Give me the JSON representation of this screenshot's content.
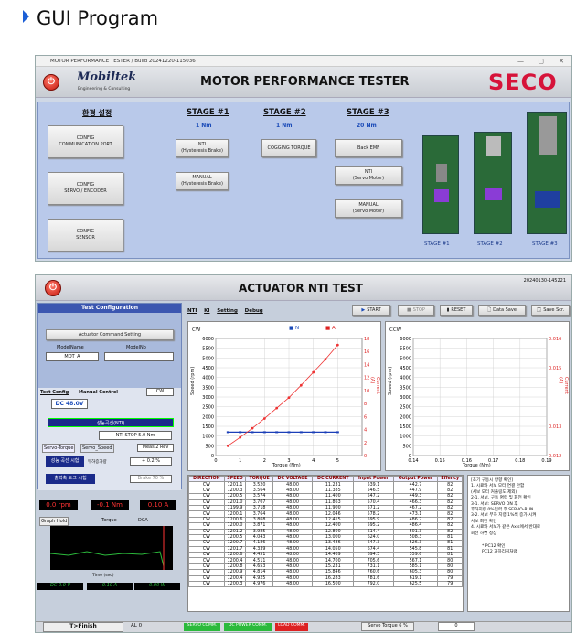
{
  "page_title": "GUI Program",
  "win1": {
    "title": "MOTOR PERFORMANCE TESTER / Build 20241220-115036",
    "logo_main": "Mobiltek",
    "logo_sub": "Engineering & Consulting",
    "heading": "MOTOR PERFORMANCE TESTER",
    "brand": "SECO",
    "env_title": "환경 설정",
    "env_buttons": [
      "CONFIG\nCOMMUNICATION PORT",
      "CONFIG\nSERVO / ENCODER",
      "CONFIG\nSENSOR"
    ],
    "stages": [
      {
        "title": "STAGE #1",
        "torque": "1 Nm",
        "buttons": [
          "NTI\n(Hysteresis Brake)",
          "MANUAL\n(Hysteresis Brake)"
        ]
      },
      {
        "title": "STAGE  #2",
        "torque": "1 Nm",
        "buttons": [
          "COGGING TORQUE"
        ]
      },
      {
        "title": "STAGE #3",
        "torque": "20 Nm",
        "buttons": [
          "Back EMF",
          "NTI\n(Servo Motor)",
          "MANUAL\n(Servo Motor)"
        ]
      }
    ],
    "stage_images": [
      "STAGE #1",
      "STAGE #2",
      "STAGE #3"
    ]
  },
  "win2": {
    "heading": "ACTUATOR NTI TEST",
    "timestamp": "20240130-145221",
    "test_config": "Test Configuration",
    "actuator_cmd": "Actuator Command Setting",
    "model_name_label": "ModelName",
    "model_no_label": "ModelNo",
    "model_name": "MOT_A",
    "model_no": "",
    "tab_test": "Test Config",
    "tab_manual": "Manual Control",
    "dir": "CW",
    "voltage": "DC 48.0V",
    "perf_curve": "성능곡선(NTI)",
    "nti_stop": "NTI STOP 5.0 Nm",
    "servo_torque_tab": "Servo-Torque",
    "servo_speed_tab": "Servo_Speed",
    "meas": "Meas 2 Rev",
    "perf_cond": "성능 곡선 시험",
    "load_dir": "부하증가량",
    "load_val": "+ 0.2 %",
    "output_torque": "출력축 토크 시험",
    "brake": "Brake 70 %",
    "rpm": "0.0 rpm",
    "nm": "-0.1 Nm",
    "amp": "0.10 A",
    "graph_hold": "Graph Hold",
    "torque_lbl": "Torque",
    "dca_lbl": "DCA",
    "time_axis": "Time (sec)",
    "dcv": "DC 0.0 V",
    "dca": "0.10 A",
    "watt": "0.00 W",
    "tabs": [
      "NTI",
      "KI",
      "Setting",
      "Debug"
    ],
    "start": "START",
    "stop": "STOP",
    "reset": "RESET",
    "data_save": "Data Save",
    "save_scr": "Save Scr.",
    "chart_cw": "CW",
    "chart_ccw": "CCW",
    "legend_n": "N",
    "legend_a": "A",
    "ylabel_speed": "Speed (rpm)",
    "ylabel_current": "Current (A)",
    "xlabel": "Torque (Nm)",
    "table_headers": [
      "DIRECTION",
      "SPEED",
      "TORQUE",
      "DC VOLTAGE",
      "DC CURRENT",
      "Input Power",
      "Output Power",
      "Effency"
    ],
    "table_rows": [
      [
        "CW",
        "1201.1",
        "3.520",
        "48.00",
        "11.231",
        "539.1",
        "442.7",
        "82"
      ],
      [
        "CW",
        "1200.3",
        "3.564",
        "48.00",
        "11.385",
        "546.5",
        "447.9",
        "82"
      ],
      [
        "CW",
        "1200.5",
        "3.574",
        "48.00",
        "11.400",
        "547.2",
        "449.3",
        "82"
      ],
      [
        "CW",
        "1201.0",
        "3.707",
        "48.00",
        "11.863",
        "570.4",
        "466.3",
        "82"
      ],
      [
        "CW",
        "1199.9",
        "3.718",
        "48.00",
        "11.900",
        "571.2",
        "467.2",
        "82"
      ],
      [
        "CW",
        "1200.1",
        "3.764",
        "48.00",
        "12.046",
        "578.2",
        "473.1",
        "82"
      ],
      [
        "CW",
        "1200.6",
        "3.868",
        "48.00",
        "12.415",
        "595.9",
        "486.2",
        "82"
      ],
      [
        "CW",
        "1200.0",
        "3.871",
        "48.00",
        "12.400",
        "595.2",
        "486.4",
        "82"
      ],
      [
        "CW",
        "1201.2",
        "3.985",
        "48.00",
        "12.800",
        "614.4",
        "501.3",
        "82"
      ],
      [
        "CW",
        "1200.5",
        "4.043",
        "48.00",
        "13.000",
        "624.0",
        "508.3",
        "81"
      ],
      [
        "CW",
        "1200.7",
        "4.186",
        "48.00",
        "13.486",
        "647.3",
        "526.3",
        "81"
      ],
      [
        "CW",
        "1201.7",
        "4.339",
        "48.00",
        "14.050",
        "674.4",
        "545.8",
        "81"
      ],
      [
        "CW",
        "1200.6",
        "4.451",
        "48.00",
        "14.469",
        "694.5",
        "559.6",
        "81"
      ],
      [
        "CW",
        "1200.4",
        "4.511",
        "48.00",
        "14.700",
        "705.6",
        "567.1",
        "80"
      ],
      [
        "CW",
        "1200.8",
        "4.653",
        "48.00",
        "15.231",
        "731.1",
        "585.1",
        "80"
      ],
      [
        "CW",
        "1200.9",
        "4.814",
        "48.00",
        "15.846",
        "760.6",
        "605.3",
        "80"
      ],
      [
        "CW",
        "1200.4",
        "4.925",
        "48.00",
        "16.283",
        "781.6",
        "619.1",
        "79"
      ],
      [
        "CW",
        "1200.3",
        "4.976",
        "48.00",
        "16.500",
        "792.0",
        "625.5",
        "79"
      ]
    ],
    "notes": "[초기 구동시 방향 확인]\n1. 시료와 서보 모터 연결 안함\n(서보 모터 커플링도 제외)\n2-1. 서보, 구동 명령 및 회전 확인\n3-1. 서보: SERVO ON 후\n후하지령 0%입력 후 SERVO-RUN\n3-2. 서보 부하 지령 1%씩 증가 시켜\n서보 회전 확인\n4. 시료와 서보가 같은 Axis에서 반대로\n회전 하면 정상",
    "notes2": "* PC12 확인\nPC12 과하리히처럼",
    "bottom": {
      "finish": "T>Finish",
      "al": "AL 0",
      "servo_comm": "SERVO COMM.",
      "dc_power": "DC POWER COMM.",
      "load_comm": "LOAD COMM.",
      "servo_torque": "Servo Torque 6 %",
      "zero": "0"
    }
  },
  "colors": {
    "accent_blue": "#1b4bb8",
    "brand_red": "#d6133a",
    "green": "#2cba3c"
  },
  "chart_data": [
    {
      "type": "scatter",
      "title": "CW",
      "xlabel": "Torque (Nm)",
      "ylabel": "Speed (rpm)",
      "y2label": "Current (A)",
      "xlim": [
        0,
        6
      ],
      "ylim": [
        0,
        6000
      ],
      "y2lim": [
        0,
        18
      ],
      "series": [
        {
          "name": "N",
          "x": [
            0.5,
            1.0,
            1.5,
            2.0,
            2.5,
            3.0,
            3.5,
            4.0,
            4.5,
            5.0
          ],
          "y": [
            1200,
            1200,
            1200,
            1200,
            1200,
            1200,
            1200,
            1200,
            1200,
            1200
          ]
        },
        {
          "name": "A",
          "x": [
            0.5,
            1.0,
            1.5,
            2.0,
            2.5,
            3.0,
            3.5,
            4.0,
            4.5,
            5.0
          ],
          "y": [
            1.5,
            2.8,
            4.2,
            5.7,
            7.3,
            8.9,
            10.8,
            12.8,
            14.8,
            17.0
          ]
        }
      ]
    },
    {
      "type": "scatter",
      "title": "CCW",
      "xlabel": "Torque (Nm)",
      "ylabel": "Speed (rpm)",
      "y2label": "Current (A)",
      "xlim": [
        0.14,
        0.19
      ],
      "ylim": [
        0,
        6000
      ],
      "y2lim": [
        0.012,
        0.016
      ],
      "series": []
    }
  ]
}
